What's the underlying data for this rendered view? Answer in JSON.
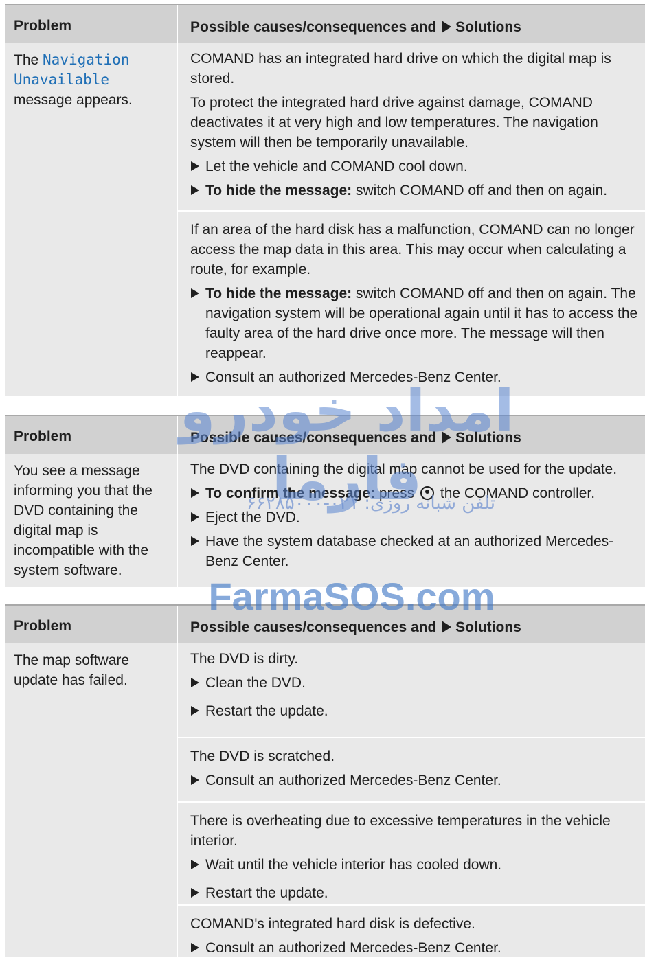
{
  "tables": [
    {
      "header": {
        "problem": "Problem",
        "causes": "Possible causes/consequences and",
        "solutions": "Solutions"
      },
      "problem_prefix": "The ",
      "problem_code": "Navigation Unavailable",
      "problem_suffix": " message appears.",
      "blocks": [
        {
          "para1": "COMAND has an integrated hard drive on which the digital map is stored.",
          "para2": "To protect the integrated hard drive against damage, COMAND deactivates it at very high and low temperatures. The navigation system will then be temporarily unavailable.",
          "step1": "Let the vehicle and COMAND cool down.",
          "step2_bold": "To hide the message:",
          "step2": " switch COMAND off and then on again."
        },
        {
          "para1": "If an area of the hard disk has a malfunction, COMAND can no longer access the map data in this area. This may occur when calculating a route, for example.",
          "step1_bold": "To hide the message:",
          "step1": " switch COMAND off and then on again. The navigation system will be operational again until it has to access the faulty area of the hard drive once more. The message will then reappear.",
          "step2": "Consult an authorized Mercedes-Benz Center."
        }
      ]
    },
    {
      "header": {
        "problem": "Problem",
        "causes": "Possible causes/consequences and",
        "solutions": "Solutions"
      },
      "problem": "You see a message informing you that the DVD containing the digital map is incompatible with the system software.",
      "para1": "The DVD containing the digital map cannot be used for the update.",
      "step1_bold": "To confirm the message:",
      "step1_a": " press ",
      "step1_b": " the COMAND controller.",
      "step2": "Eject the DVD.",
      "step3": "Have the system database checked at an authorized Mercedes-Benz Center."
    },
    {
      "header": {
        "problem": "Problem",
        "causes": "Possible causes/consequences and",
        "solutions": "Solutions"
      },
      "problem": "The map software update has failed.",
      "blocks": [
        {
          "para": "The DVD is dirty.",
          "steps": [
            "Clean the DVD.",
            "Restart the update."
          ]
        },
        {
          "para": "The DVD is scratched.",
          "steps": [
            "Consult an authorized Mercedes-Benz Center."
          ]
        },
        {
          "para": "There is overheating due to excessive temperatures in the vehicle interior.",
          "steps": [
            "Wait until the vehicle interior has cooled down.",
            "Restart the update."
          ]
        },
        {
          "para": "COMAND's integrated hard disk is defective.",
          "steps": [
            "Consult an authorized Mercedes-Benz Center."
          ]
        }
      ]
    }
  ],
  "watermark": {
    "persian_title": "امداد خودرو فارما",
    "phone_line": "تلفن شبانه روزی: ۰۲۱-۶۶۲۸۵۰۰۰",
    "site": "FarmaSOS.com"
  }
}
